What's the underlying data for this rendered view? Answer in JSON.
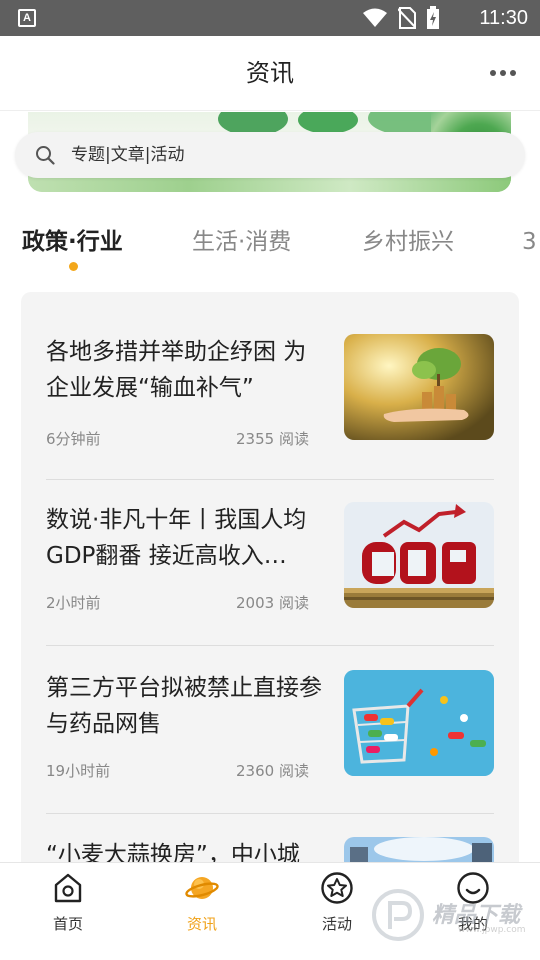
{
  "status_bar": {
    "time": "11:30",
    "app_icon": "A"
  },
  "header": {
    "title": "资讯",
    "more_icon": "more-dots-icon"
  },
  "search": {
    "placeholder": "专题|文章|活动"
  },
  "tabs": [
    {
      "label": "政策·行业",
      "active": true
    },
    {
      "label": "生活·消费",
      "active": false
    },
    {
      "label": "乡村振兴",
      "active": false
    },
    {
      "label": "3",
      "active": false
    }
  ],
  "articles": [
    {
      "title": "各地多措并举助企纾困 为企业发展“输血补气”",
      "time": "6分钟前",
      "reads": "2355 阅读",
      "image": "hand-with-coins-plant"
    },
    {
      "title": "数说·非凡十年丨我国人均GDP翻番 接近高收入…",
      "time": "2小时前",
      "reads": "2003 阅读",
      "image": "gdp-text-with-arrow"
    },
    {
      "title": "第三方平台拟被禁止直接参与药品网售",
      "time": "19小时前",
      "reads": "2360 阅读",
      "image": "cart-with-pills"
    },
    {
      "title": "“小麦大蒜换房”，中小城",
      "time": "",
      "reads": "",
      "image": "buildings-sky"
    }
  ],
  "bottom_nav": [
    {
      "label": "首页",
      "icon": "home-icon",
      "active": false
    },
    {
      "label": "资讯",
      "icon": "planet-icon",
      "active": true
    },
    {
      "label": "活动",
      "icon": "star-circle-icon",
      "active": false
    },
    {
      "label": "我的",
      "icon": "smile-face-icon",
      "active": false
    }
  ],
  "watermark": {
    "text": "精品下载",
    "url": "www.jpwp.com"
  },
  "colors": {
    "accent": "#f3a71b",
    "status_bar": "#5f5f5f",
    "card_bg": "#f4f4f4"
  }
}
